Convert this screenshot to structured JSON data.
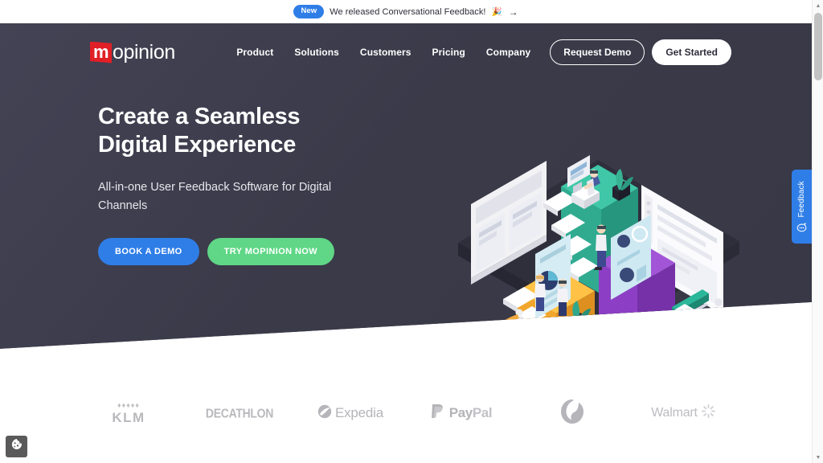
{
  "announcement": {
    "badge": "New",
    "text": "We released Conversational Feedback!",
    "emoji": "🎉",
    "arrow": "→"
  },
  "header": {
    "logo": {
      "mark": "m",
      "word": "opinion"
    },
    "nav": [
      {
        "label": "Product"
      },
      {
        "label": "Solutions"
      },
      {
        "label": "Customers"
      },
      {
        "label": "Pricing"
      },
      {
        "label": "Company"
      }
    ],
    "request_demo": "Request Demo",
    "get_started": "Get Started"
  },
  "hero": {
    "title_line1": "Create a Seamless",
    "title_line2": "Digital Experience",
    "subtitle": "All-in-one User Feedback Software for Digital Channels",
    "cta_primary": "BOOK A DEMO",
    "cta_secondary": "TRY MOPINION NOW"
  },
  "brands": [
    {
      "name": "KLM",
      "crown": "♦♦♦♦♦",
      "label": "KLM"
    },
    {
      "name": "Decathlon",
      "label": "DECATHLON"
    },
    {
      "name": "Expedia",
      "label": "Expedia"
    },
    {
      "name": "PayPal",
      "label_bold": "Pay",
      "label_light": "Pal"
    },
    {
      "name": "Vodafone",
      "label": ""
    },
    {
      "name": "Walmart",
      "label": "Walmart"
    }
  ],
  "feedback_tab": {
    "label": "Feedback"
  },
  "colors": {
    "hero_bg": "#3c3c4c",
    "accent_blue": "#2f7ee8",
    "accent_green": "#5fd786",
    "logo_red": "#e01f26",
    "teal_block": "#35b79a",
    "purple_block": "#8c3fc4",
    "yellow_block": "#f5a623"
  }
}
